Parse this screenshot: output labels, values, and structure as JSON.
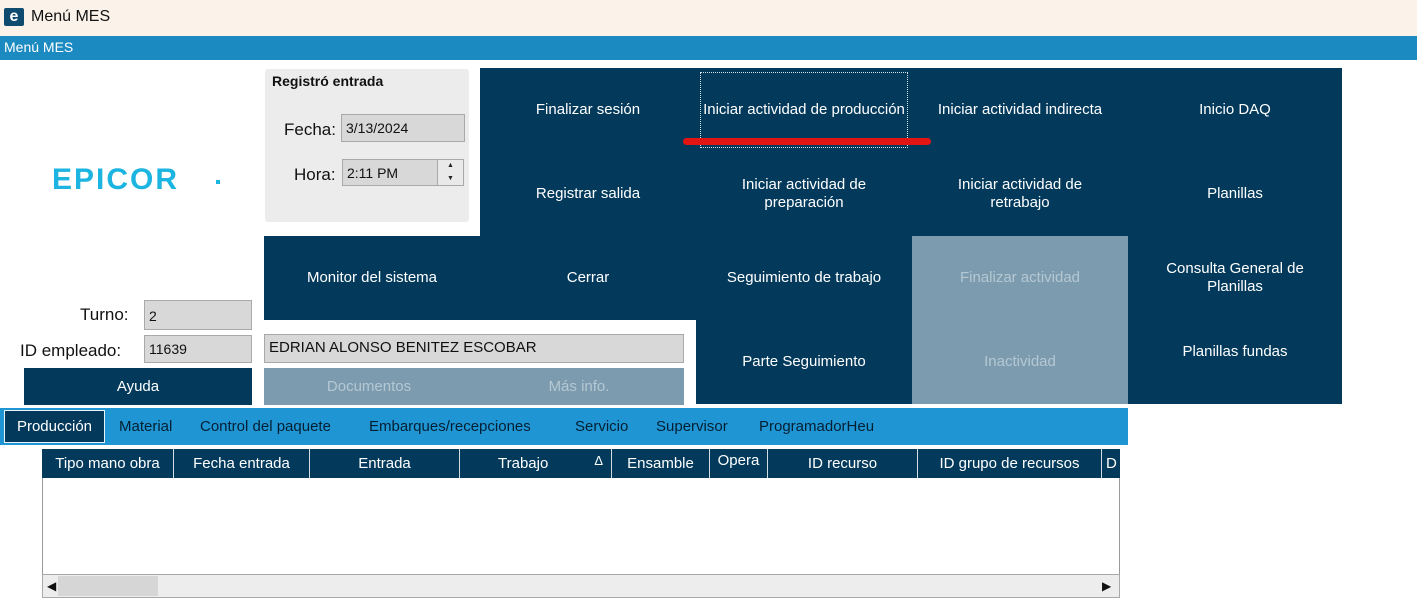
{
  "window": {
    "title": "Menú MES",
    "icon": "epicor-e-icon",
    "icon_glyph": "e"
  },
  "header": {
    "title": "Menú MES"
  },
  "logo": {
    "text": "EPICOR"
  },
  "clock_in": {
    "title": "Registró entrada",
    "date_label": "Fecha:",
    "date_value": "3/13/2024",
    "time_label": "Hora:",
    "time_value": "2:11 PM"
  },
  "employee": {
    "shift_label": "Turno:",
    "shift_value": "2",
    "id_label": "ID empleado:",
    "id_value": "11639",
    "name": "EDRIAN ALONSO BENITEZ ESCOBAR"
  },
  "buttons": {
    "help": "Ayuda",
    "documents": "Documentos",
    "more_info": "Más info.",
    "logout": "Finalizar sesión",
    "start_production": "Iniciar actividad de producción",
    "start_indirect": "Iniciar actividad indirecta",
    "start_daq": "Inicio DAQ",
    "clock_out": "Registrar salida",
    "start_setup": "Iniciar actividad de preparación",
    "start_rework": "Iniciar actividad de retrabajo",
    "templates": "Planillas",
    "system_monitor": "Monitor del sistema",
    "close": "Cerrar",
    "job_tracking": "Seguimiento de trabajo",
    "end_activity": "Finalizar actividad",
    "templates_general_query": "Consulta General de Planillas",
    "tracking_part": "Parte Seguimiento",
    "inactivity": "Inactividad",
    "casting_templates": "Planillas fundas"
  },
  "tabs": [
    {
      "label": "Producción",
      "active": true
    },
    {
      "label": "Material"
    },
    {
      "label": "Control del paquete"
    },
    {
      "label": "Embarques/recepciones"
    },
    {
      "label": "Servicio"
    },
    {
      "label": "Supervisor"
    },
    {
      "label": "ProgramadorHeu"
    }
  ],
  "grid": {
    "columns": [
      "Tipo mano obra",
      "Fecha entrada",
      "Entrada",
      "Trabajo",
      "Ensamble",
      "Opera",
      "ID recurso",
      "ID grupo de recursos",
      "D"
    ],
    "sort_indicator": "Δ",
    "rows": []
  },
  "colors": {
    "navy_tile": "#033a5c",
    "disabled_tile": "#7d9baf",
    "header_band": "#1b8ac1",
    "tab_bar": "#1f96d3",
    "highlight_underline": "#e31414",
    "logo": "#1cb4e0"
  }
}
